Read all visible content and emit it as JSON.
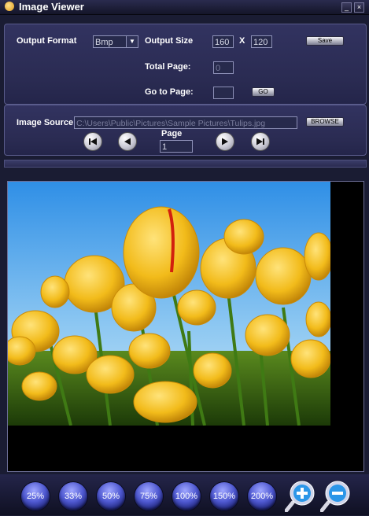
{
  "window": {
    "title": "Image Viewer"
  },
  "output": {
    "format_label": "Output Format",
    "format_value": "Bmp",
    "size_label": "Output Size",
    "width": "160",
    "x_label": "X",
    "height": "120",
    "save_label": "Save",
    "total_page_label": "Total Page:",
    "total_page_value": "0",
    "goto_label": "Go to Page:",
    "goto_value": "",
    "go_label": "GO"
  },
  "source": {
    "label": "Image Source",
    "path": "C:\\Users\\Public\\Pictures\\Sample Pictures\\Tulips.jpg",
    "browse_label": "BROWSE",
    "page_label": "Page",
    "page_value": "1"
  },
  "zoom": {
    "levels": [
      "25%",
      "33%",
      "50%",
      "75%",
      "100%",
      "150%",
      "200%"
    ]
  }
}
